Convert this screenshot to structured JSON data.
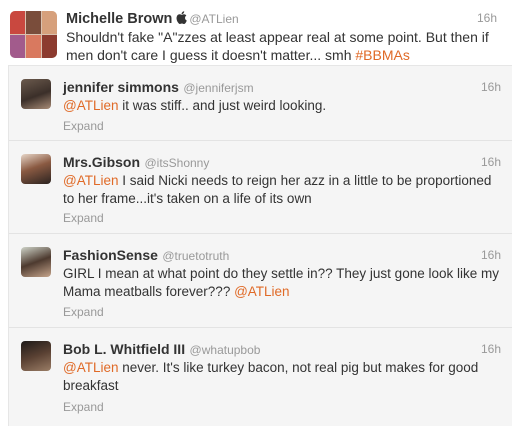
{
  "main_tweet": {
    "name": "Michelle Brown",
    "icon": "apple-icon",
    "handle": "@ATLien",
    "time": "16h",
    "text_parts": [
      "Shouldn't fake \"A\"zzes at least appear real at some point. But then if men don't care I guess it doesn't matter... smh ",
      "#BBMAs"
    ]
  },
  "replies": [
    {
      "name": "jennifer simmons",
      "handle": "@jenniferjsm",
      "time": "16h",
      "mention": "@ATLien",
      "text": " it was stiff.. and just weird looking.",
      "expand": "Expand"
    },
    {
      "name": "Mrs.Gibson",
      "handle": "@itsShonny",
      "time": "16h",
      "mention": "@ATLien",
      "text": " I said Nicki needs to reign her azz in a little to be proportioned to her frame...it's taken on a life of its own",
      "expand": "Expand"
    },
    {
      "name": "FashionSense",
      "handle": "@truetotruth",
      "time": "16h",
      "text": "GIRL I mean at what point do they settle in?? They just gone look like my Mama meatballs forever??? ",
      "mention": "@ATLien",
      "expand": "Expand"
    },
    {
      "name": "Bob L. Whitfield III",
      "handle": "@whatupbob",
      "time": "16h",
      "mention": "@ATLien",
      "text": " never. It's like turkey bacon, not real pig but makes for good breakfast",
      "expand": "Expand"
    }
  ],
  "colors": {
    "accent": "#e06a27",
    "muted": "#999999",
    "reply_bg": "#f5f5f5"
  }
}
